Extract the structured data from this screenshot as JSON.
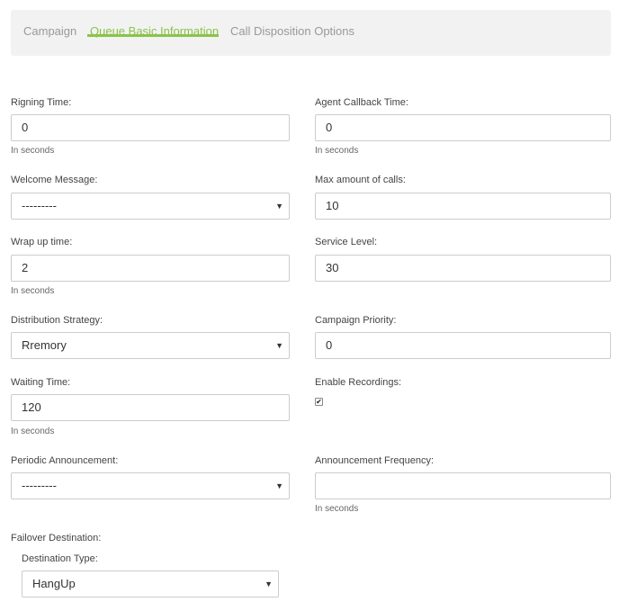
{
  "tabs": [
    {
      "label": "Campaign"
    },
    {
      "label": "Queue Basic Information"
    },
    {
      "label": "Call Disposition Options"
    }
  ],
  "units_hint": "In seconds",
  "form": {
    "ringing_time": {
      "label": "Rigning Time:",
      "value": "0"
    },
    "agent_callback_time": {
      "label": "Agent Callback Time:",
      "value": "0"
    },
    "welcome_message": {
      "label": "Welcome Message:",
      "value": "---------"
    },
    "max_calls": {
      "label": "Max amount of calls:",
      "value": "10"
    },
    "wrap_up_time": {
      "label": "Wrap up time:",
      "value": "2"
    },
    "service_level": {
      "label": "Service Level:",
      "value": "30"
    },
    "distribution_strategy": {
      "label": "Distribution Strategy:",
      "value": "Rremory"
    },
    "campaign_priority": {
      "label": "Campaign Priority:",
      "value": "0"
    },
    "waiting_time": {
      "label": "Waiting Time:",
      "value": "120"
    },
    "enable_recordings": {
      "label": "Enable Recordings:",
      "checked": true
    },
    "periodic_announcement": {
      "label": "Periodic Announcement:",
      "value": "---------"
    },
    "announcement_frequency": {
      "label": "Announcement Frequency:",
      "value": ""
    },
    "failover_destination": {
      "label": "Failover Destination:"
    },
    "destination_type": {
      "label": "Destination Type:",
      "value": "HangUp"
    }
  },
  "colors": {
    "accent": "#8bc34a",
    "tab_inactive": "#999999",
    "tabbar_bg": "#f2f2f2",
    "border": "#cccccc"
  },
  "icons": {
    "select_arrow": "chevron-down-icon",
    "checkbox": "checkbox-checked-icon"
  }
}
